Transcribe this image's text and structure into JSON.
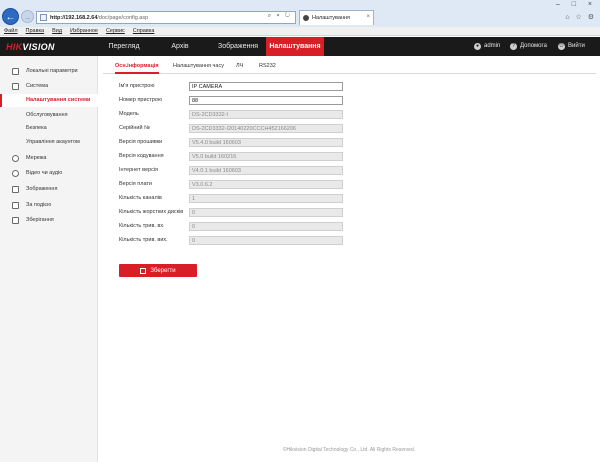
{
  "browser": {
    "url_host": "http://192.168.2.64",
    "url_path": "/doc/page/config.asp",
    "tab_title": "Налаштування",
    "menu": [
      "Файл",
      "Правка",
      "Вид",
      "Избранное",
      "Сервис",
      "Справка"
    ]
  },
  "header": {
    "logo_prefix": "HIK",
    "logo_suffix": "VISION",
    "tabs": [
      "Перегляд",
      "Архів",
      "Зображення",
      "Налаштування"
    ],
    "user": "admin",
    "help": "Допомога",
    "logout": "Вийти"
  },
  "sidebar": {
    "items": [
      {
        "label": "Локальні параметри",
        "icon": "monitor-icon"
      },
      {
        "label": "Система",
        "icon": "system-icon"
      },
      {
        "label": "Мережа",
        "icon": "globe-icon"
      },
      {
        "label": "Відео чи аудіо",
        "icon": "video-icon"
      },
      {
        "label": "Зображення",
        "icon": "image-icon"
      },
      {
        "label": "За подією",
        "icon": "event-icon"
      },
      {
        "label": "Зберігання",
        "icon": "storage-icon"
      }
    ],
    "subitems": [
      "Налаштування системи",
      "Обслуговування",
      "Безпека",
      "Управління акаунтом"
    ]
  },
  "content": {
    "subtabs": [
      "Осн.інформація",
      "Налаштування часу",
      "ЛЧ",
      "RS232"
    ],
    "fields": [
      {
        "label": "Ім'я пристрою",
        "value": "IP CAMERA",
        "readonly": false
      },
      {
        "label": "Номер пристрою",
        "value": "88",
        "readonly": false
      },
      {
        "label": "Модель",
        "value": "DS-2CD3332-I",
        "readonly": true
      },
      {
        "label": "Серійний №",
        "value": "DS-2CD3332-I20140220CCCH452166206",
        "readonly": true
      },
      {
        "label": "Версія прошивки",
        "value": "V5.4.0 build 160603",
        "readonly": true
      },
      {
        "label": "Версія кодування",
        "value": "V5.0 build 160216",
        "readonly": true
      },
      {
        "label": "Інтернет версія",
        "value": "V4.0.1 build 160603",
        "readonly": true
      },
      {
        "label": "Версія плати",
        "value": "V3.0.6.2",
        "readonly": true
      },
      {
        "label": "Кількість каналів",
        "value": "1",
        "readonly": true
      },
      {
        "label": "Кількість жорстких дисків",
        "value": "0",
        "readonly": true
      },
      {
        "label": "Кількість трив. вх.",
        "value": "0",
        "readonly": true
      },
      {
        "label": "Кількість трив. вих.",
        "value": "0",
        "readonly": true
      }
    ],
    "save_label": "Зберегти"
  },
  "footer": "©Hikvision Digital Technology Co., Ltd. All Rights Reserved.",
  "colors": {
    "accent": "#d81e27",
    "header_bg": "#1a1a1a"
  }
}
